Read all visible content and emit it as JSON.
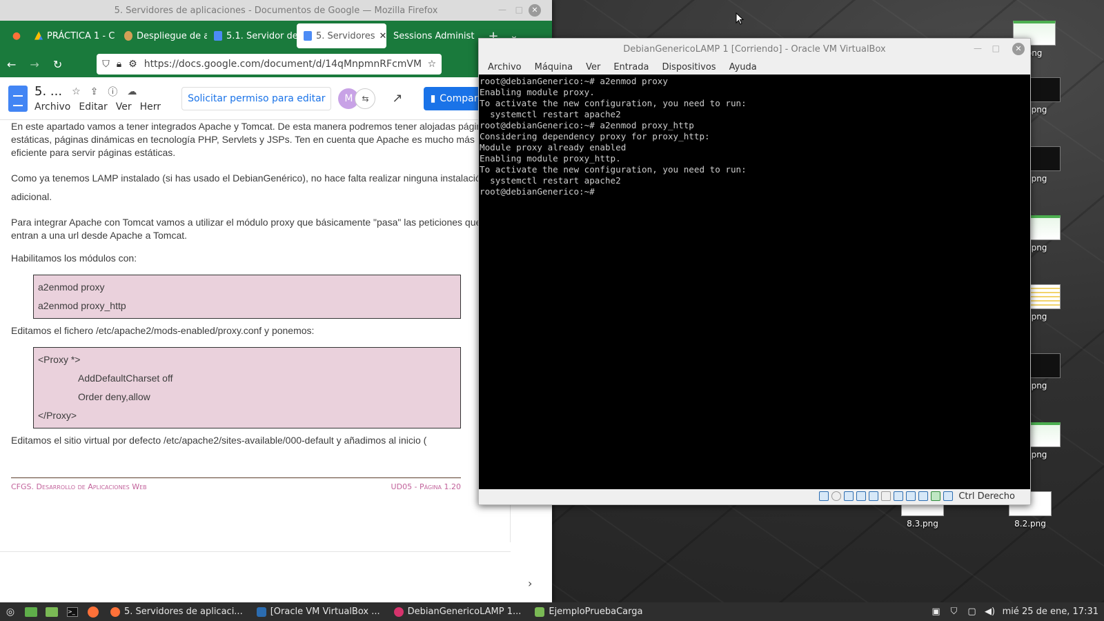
{
  "firefox": {
    "window_title": "5. Servidores de aplicaciones - Documentos de Google — Mozilla Firefox",
    "tabs": [
      {
        "label": "PRÁCTICA 1 - C"
      },
      {
        "label": "Despliegue de a"
      },
      {
        "label": "5.1. Servidor de"
      },
      {
        "label": "5. Servidores"
      },
      {
        "label": "Sessions Administ"
      }
    ],
    "url": "https://docs.google.com/document/d/14qMnpmnRFcmVM(",
    "docs": {
      "title": "5. ...",
      "menu": [
        "Archivo",
        "Editar",
        "Ver",
        "Herr"
      ],
      "request_edit": "Solicitar permiso para editar",
      "avatar_letter": "M",
      "share": "Compar"
    },
    "page": {
      "p1": "En este apartado vamos a tener integrados Apache y Tomcat. De esta manera podremos tener alojadas página estáticas, páginas dinámicas en tecnología PHP, Servlets y JSPs. Ten en cuenta que Apache es mucho más eficiente para servir páginas estáticas.",
      "p2": "Como ya tenemos LAMP instalado (si has usado el DebianGenérico), no hace falta realizar ninguna instalación adicional.",
      "p3": "Para integrar Apache con Tomcat vamos a utilizar el módulo proxy que básicamente \"pasa\" las peticiones que entran a una url desde Apache a Tomcat.",
      "p4": "Habilitamos los módulos con:",
      "code1": [
        "a2enmod proxy",
        "a2enmod proxy_http"
      ],
      "p5": "Editamos el fichero /etc/apache2/mods-enabled/proxy.conf y ponemos:",
      "code2": [
        "<Proxy *>",
        "AddDefaultCharset off",
        "Order deny,allow",
        "</Proxy>"
      ],
      "p6": "Editamos el sitio virtual por defecto /etc/apache2/sites-available/000-default y añadimos al inicio (",
      "footer_left": "CFGS. Desarrollo de Aplicaciones Web",
      "footer_right": "UD05 - Página 1.20"
    }
  },
  "virtualbox": {
    "title": "DebianGenericoLAMP 1 [Corriendo] - Oracle VM VirtualBox",
    "menu": [
      "Archivo",
      "Máquina",
      "Ver",
      "Entrada",
      "Dispositivos",
      "Ayuda"
    ],
    "terminal_lines": [
      "root@debianGenerico:~# a2enmod proxy",
      "Enabling module proxy.",
      "To activate the new configuration, you need to run:",
      "  systemctl restart apache2",
      "root@debianGenerico:~# a2enmod proxy_http",
      "Considering dependency proxy for proxy_http:",
      "Module proxy already enabled",
      "Enabling module proxy_http.",
      "To activate the new configuration, you need to run:",
      "  systemctl restart apache2",
      "root@debianGenerico:~#"
    ],
    "host_key": "Ctrl Derecho"
  },
  "desktop": {
    "icons": [
      "png",
      "png",
      "png",
      "png",
      "png",
      "png",
      "png",
      "8.3.png",
      "8.2.png"
    ]
  },
  "taskbar": {
    "tasks": [
      "5. Servidores de aplicaci...",
      "[Oracle VM VirtualBox ...",
      "DebianGenericoLAMP 1...",
      "EjemploPruebaCarga"
    ],
    "clock": "mié 25 de ene, 17:31"
  }
}
